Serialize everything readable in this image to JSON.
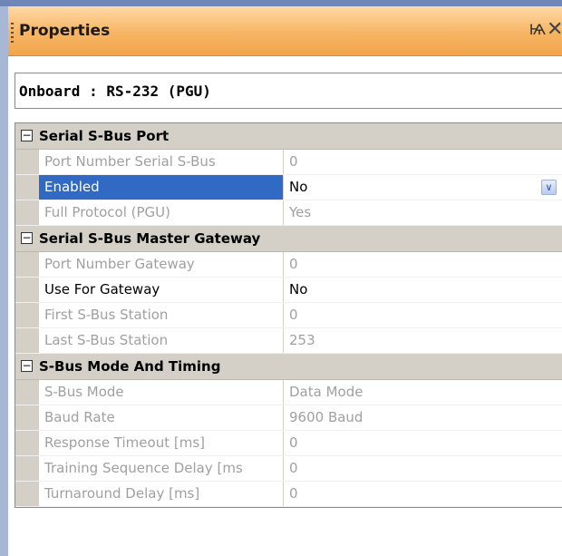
{
  "panel": {
    "title": "Properties",
    "pin_glyph": "Ѩ",
    "close_glyph": "✕",
    "object_selector": "Onboard : RS-232 (PGU)"
  },
  "categories": [
    {
      "label": "Serial S-Bus Port",
      "toggle": "−",
      "rows": [
        {
          "name": "Port Number Serial S-Bus",
          "value": "0",
          "state": "readonly"
        },
        {
          "name": "Enabled",
          "value": "No",
          "state": "selected"
        },
        {
          "name": "Full Protocol (PGU)",
          "value": "Yes",
          "state": "readonly"
        }
      ]
    },
    {
      "label": "Serial S-Bus Master Gateway",
      "toggle": "−",
      "rows": [
        {
          "name": "Port Number Gateway",
          "value": "0",
          "state": "readonly"
        },
        {
          "name": "Use For Gateway",
          "value": "No",
          "state": "active"
        },
        {
          "name": "First S-Bus Station",
          "value": "0",
          "state": "readonly"
        },
        {
          "name": "Last S-Bus Station",
          "value": "253",
          "state": "readonly"
        }
      ]
    },
    {
      "label": "S-Bus Mode And Timing",
      "toggle": "−",
      "rows": [
        {
          "name": "S-Bus Mode",
          "value": "Data Mode",
          "state": "readonly"
        },
        {
          "name": "Baud Rate",
          "value": "9600 Baud",
          "state": "readonly"
        },
        {
          "name": "Response Timeout [ms]",
          "value": "0",
          "state": "readonly"
        },
        {
          "name": "Training Sequence Delay [ms",
          "value": "0",
          "state": "readonly"
        },
        {
          "name": "Turnaround Delay [ms]",
          "value": "0",
          "state": "readonly"
        }
      ]
    }
  ],
  "dropdown_glyph": "∨",
  "colors": {
    "title_gradient": "#f6b463",
    "selection": "#316ac5",
    "category_bg": "#d4d0c8",
    "readonly_text": "#a0a0a0"
  }
}
